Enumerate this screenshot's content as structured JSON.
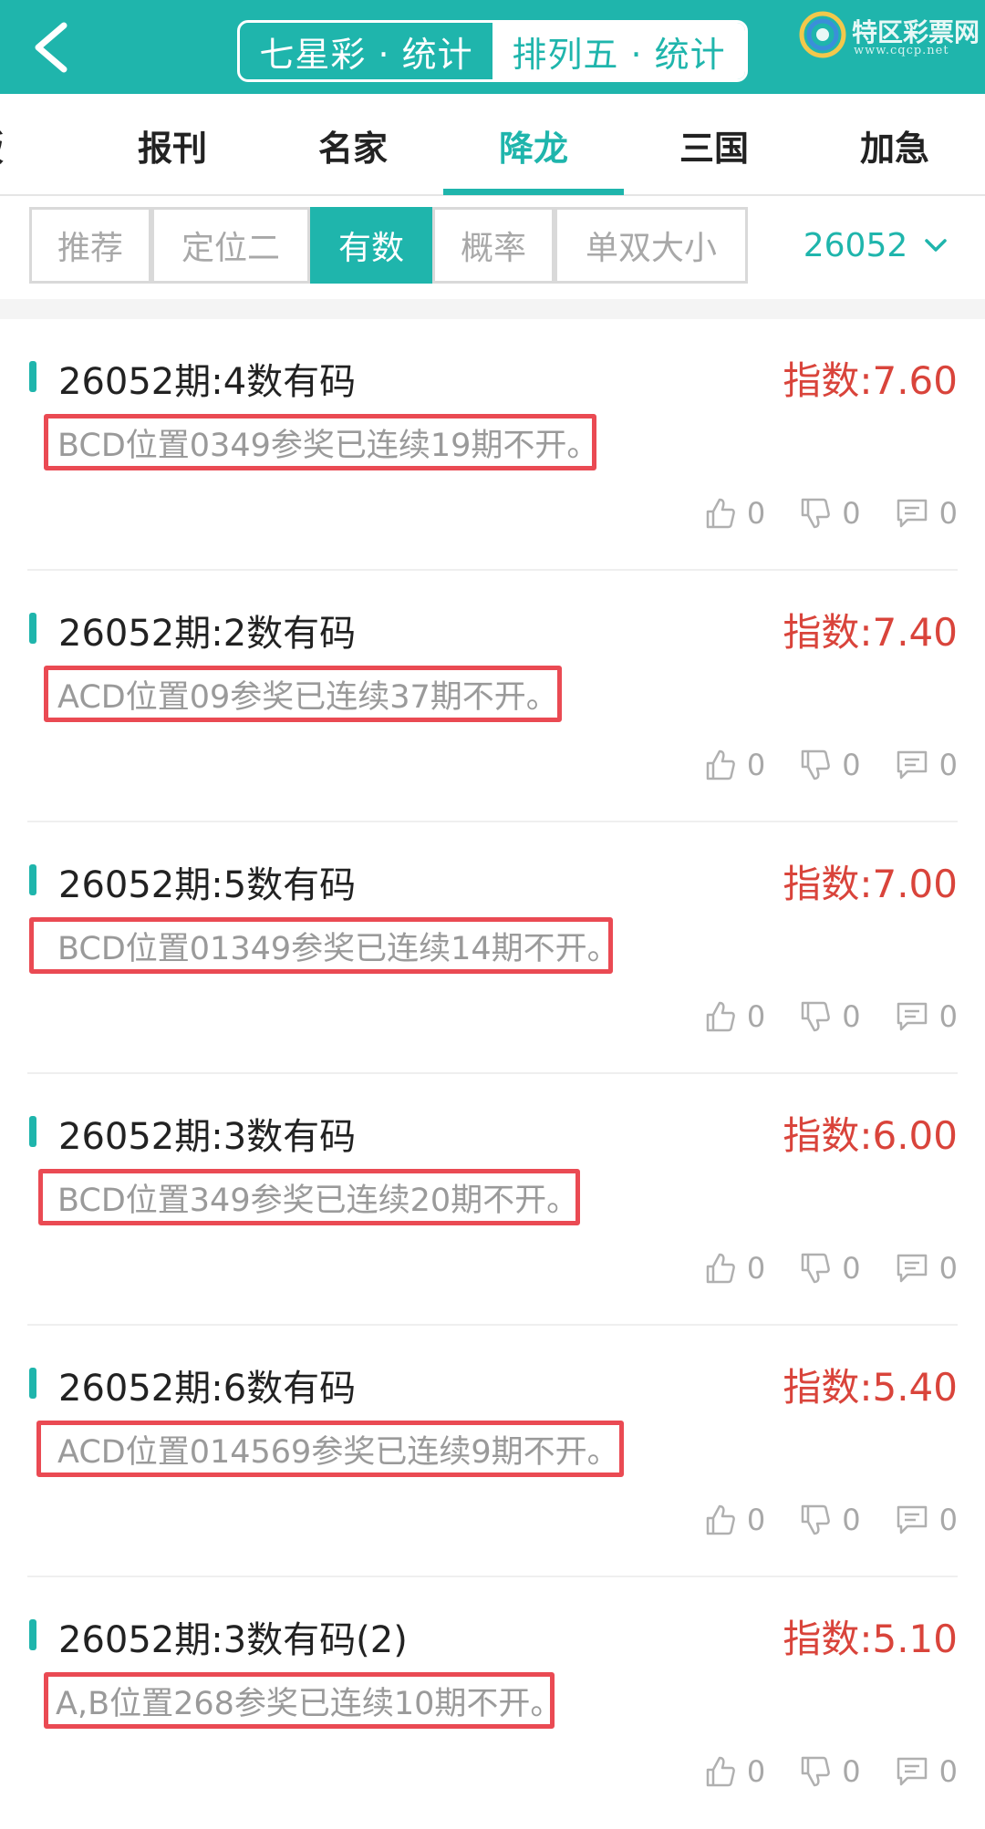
{
  "header": {
    "seg_tabs": [
      {
        "label": "七星彩 · 统计",
        "active": false
      },
      {
        "label": "排列五 · 统计",
        "active": true
      }
    ],
    "logo_text": "特区彩票网",
    "logo_sub": "www.cqcp.net"
  },
  "nav": {
    "tabs": [
      {
        "label": "版"
      },
      {
        "label": "报刊"
      },
      {
        "label": "名家"
      },
      {
        "label": "降龙"
      },
      {
        "label": "三国"
      },
      {
        "label": "加急"
      }
    ],
    "active_tab": "降龙"
  },
  "filters": {
    "chips": [
      {
        "label": "推荐"
      },
      {
        "label": "定位二"
      },
      {
        "label": "有数"
      },
      {
        "label": "概率"
      },
      {
        "label": "单双大小"
      }
    ],
    "active_chip": "有数",
    "period": "26052"
  },
  "cards": [
    {
      "title": "26052期:4数有码",
      "index": "指数:7.60",
      "desc": "BCD位置0349参奖已连续19期不开。",
      "likes": "0",
      "dislikes": "0",
      "comments": "0"
    },
    {
      "title": "26052期:2数有码",
      "index": "指数:7.40",
      "desc": "ACD位置09参奖已连续37期不开。",
      "likes": "0",
      "dislikes": "0",
      "comments": "0"
    },
    {
      "title": "26052期:5数有码",
      "index": "指数:7.00",
      "desc": "BCD位置01349参奖已连续14期不开。",
      "likes": "0",
      "dislikes": "0",
      "comments": "0"
    },
    {
      "title": "26052期:3数有码",
      "index": "指数:6.00",
      "desc": "BCD位置349参奖已连续20期不开。",
      "likes": "0",
      "dislikes": "0",
      "comments": "0"
    },
    {
      "title": "26052期:6数有码",
      "index": "指数:5.40",
      "desc": "ACD位置014569参奖已连续9期不开。",
      "likes": "0",
      "dislikes": "0",
      "comments": "0"
    },
    {
      "title": "26052期:3数有码(2)",
      "index": "指数:5.10",
      "desc": "A,B位置268参奖已连续10期不开。",
      "likes": "0",
      "dislikes": "0",
      "comments": "0"
    }
  ],
  "colors": {
    "brand": "#1fb5ac",
    "index_red": "#d9443b",
    "highlight_box": "#ea4a53"
  },
  "icons": {
    "back": "chevron-left-icon",
    "dropdown": "chevron-down-icon",
    "like": "thumbs-up-icon",
    "dislike": "thumbs-down-icon",
    "comment": "comment-icon"
  }
}
